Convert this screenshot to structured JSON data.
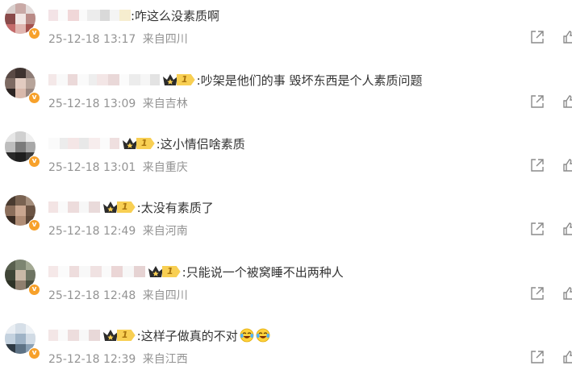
{
  "comments": [
    {
      "text": ":咋这么没素质啊",
      "date": "25-12-18 13:17",
      "location": "来自四川",
      "badge_level": "",
      "emoji_count": 0
    },
    {
      "text": ":吵架是他们的事 毁坏东西是个人素质问题",
      "date": "25-12-18 13:09",
      "location": "来自吉林",
      "badge_level": "1",
      "emoji_count": 0
    },
    {
      "text": ":这小情侣啥素质",
      "date": "25-12-18 13:01",
      "location": "来自重庆",
      "badge_level": "1",
      "emoji_count": 0
    },
    {
      "text": ":太没有素质了",
      "date": "25-12-18 12:49",
      "location": "来自河南",
      "badge_level": "1",
      "emoji_count": 0
    },
    {
      "text": ":只能说一个被窝睡不出两种人",
      "date": "25-12-18 12:48",
      "location": "来自四川",
      "badge_level": "1",
      "emoji_count": 0
    },
    {
      "text": ":这样子做真的不对",
      "date": "25-12-18 12:39",
      "location": "来自江西",
      "badge_level": "1",
      "emoji_count": 2
    }
  ],
  "icons": {
    "share": "share-icon",
    "like": "thumbs-up-icon",
    "verified": "verified-badge-icon",
    "crown": "crown-icon",
    "emoji": "crying-laughing-emoji-icon"
  },
  "colors": {
    "text": "#333333",
    "meta": "#939393",
    "verified_badge": "#f7a12b",
    "level_badge": "#f8cf53",
    "crown": "#2b2b2b"
  }
}
